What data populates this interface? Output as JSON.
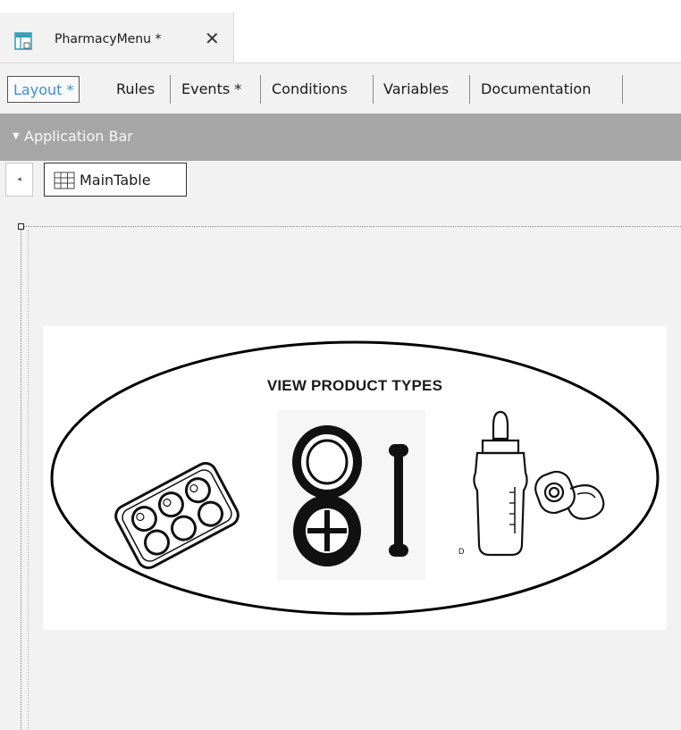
{
  "document_tab": {
    "title": "PharmacyMenu *",
    "close": "✕"
  },
  "part_tabs": [
    {
      "label": "Layout *",
      "active": true
    },
    {
      "label": "Rules",
      "active": false
    },
    {
      "label": "Events *",
      "active": false
    },
    {
      "label": "Conditions",
      "active": false
    },
    {
      "label": "Variables",
      "active": false
    },
    {
      "label": "Documentation",
      "active": false
    }
  ],
  "app_bar": {
    "label": "Application Bar"
  },
  "breadcrumb": {
    "back": "◂",
    "item": "MainTable"
  },
  "image": {
    "title": "VIEW PRODUCT TYPES",
    "small_mark": "D"
  },
  "colors": {
    "accent": "#3d8fd8",
    "app_bar": "#a6a6a6",
    "canvas": "#f2f2f2"
  }
}
